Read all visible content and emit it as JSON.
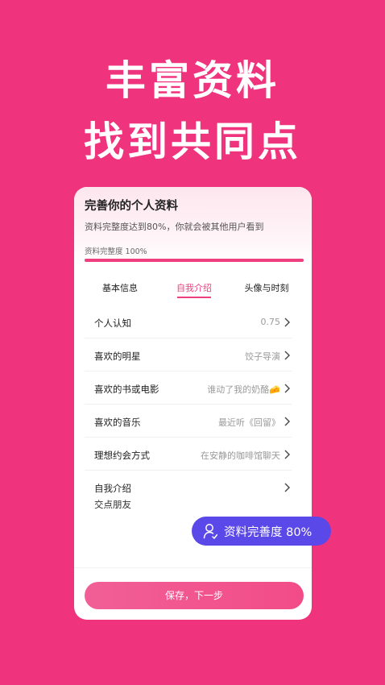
{
  "headline": {
    "line1": "丰富资料",
    "line2": "找到共同点"
  },
  "card": {
    "title": "完善你的个人资料",
    "subtitle": "资料完整度达到80%，你就会被其他用户看到",
    "progress_label": "资料完整度 100%",
    "progress_value": 100
  },
  "tabs": [
    {
      "label": "基本信息",
      "active": false
    },
    {
      "label": "自我介绍",
      "active": true
    },
    {
      "label": "头像与时刻",
      "active": false
    }
  ],
  "rows": [
    {
      "label": "个人认知",
      "value": "0.75"
    },
    {
      "label": "喜欢的明星",
      "value": "饺子导演"
    },
    {
      "label": "喜欢的书或电影",
      "value": "谁动了我的奶酪🧀"
    },
    {
      "label": "喜欢的音乐",
      "value": "最近听《回留》"
    },
    {
      "label": "理想约会方式",
      "value": "在安静的咖啡馆聊天"
    },
    {
      "label": "自我介绍",
      "value": ""
    }
  ],
  "intro_text": "交点朋友",
  "save_button": "保存，下一步",
  "badge": {
    "text": "资料完善度 80%",
    "icon": "user-icon"
  },
  "colors": {
    "brand": "#F0337D",
    "accent": "#EE3F7E",
    "badge": "#5B48E8"
  }
}
